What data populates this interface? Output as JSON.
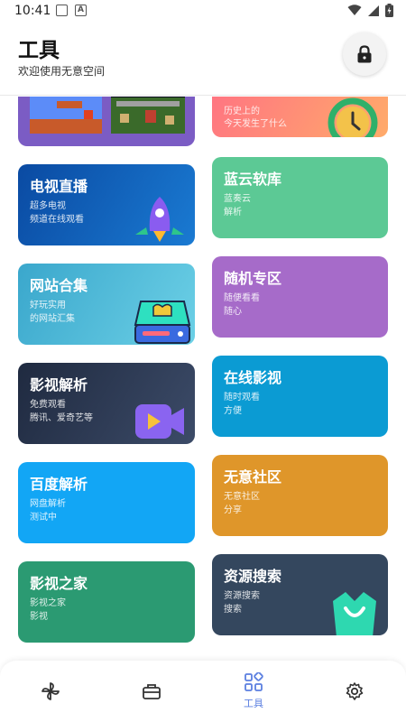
{
  "status_bar": {
    "time": "10:41"
  },
  "header": {
    "title": "工具",
    "subtitle": "欢迎使用无意空间"
  },
  "cards": [
    {
      "title": "",
      "line1": "",
      "line2": "",
      "color": "#7b5cc4"
    },
    {
      "title": "",
      "line1": "历史上的",
      "line2": "今天发生了什么",
      "color": "#ff8a7a"
    },
    {
      "title": "电视直播",
      "line1": "超多电视",
      "line2": "频道在线观看",
      "color": "#0b5fb5"
    },
    {
      "title": "蓝云软库",
      "line1": "蓝奏云",
      "line2": "解析",
      "color": "#5cc995"
    },
    {
      "title": "网站合集",
      "line1": "好玩实用",
      "line2": "的网站汇集",
      "color": "#4fbad8"
    },
    {
      "title": "随机专区",
      "line1": "随便看看",
      "line2": "随心",
      "color": "#a66bc9"
    },
    {
      "title": "影视解析",
      "line1": "免费观看",
      "line2": "腾讯、爱奇艺等",
      "color": "#2f3c55"
    },
    {
      "title": "在线影视",
      "line1": "随时观看",
      "line2": "方便",
      "color": "#0b9bd3"
    },
    {
      "title": "百度解析",
      "line1": "网盘解析",
      "line2": "测试中",
      "color": "#12a6f5"
    },
    {
      "title": "无意社区",
      "line1": "无意社区",
      "line2": "分享",
      "color": "#df962a"
    },
    {
      "title": "影视之家",
      "line1": "影视之家",
      "line2": "影视",
      "color": "#2b9a72"
    },
    {
      "title": "资源搜索",
      "line1": "资源搜索",
      "line2": "搜索",
      "color": "#34475e"
    }
  ],
  "bottom_nav": {
    "items": [
      {
        "icon": "pinwheel-icon",
        "label": ""
      },
      {
        "icon": "toolbox-icon",
        "label": ""
      },
      {
        "icon": "tools-grid-icon",
        "label": "工具",
        "active": true
      },
      {
        "icon": "gear-icon",
        "label": ""
      }
    ],
    "active_color": "#5b7fe0"
  }
}
